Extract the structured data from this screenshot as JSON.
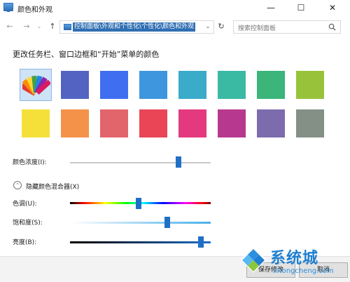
{
  "window": {
    "title": "颜色和外观",
    "minimize_glyph": "—",
    "maximize_glyph": "☐",
    "close_glyph": "✕"
  },
  "nav": {
    "back_glyph": "←",
    "forward_glyph": "→",
    "recent_glyph": "⌄",
    "up_glyph": "↑",
    "address": "控制面板\\外观和个性化\\个性化\\颜色和外观",
    "refresh_glyph": "↻",
    "dropdown_glyph": "⌄",
    "search_placeholder": "搜索控制面板"
  },
  "heading": "更改任务栏、窗口边框和“开始”菜单的颜色",
  "swatches": {
    "row1": [
      "custom",
      "#5363c2",
      "#3f6ff0",
      "#3d96de",
      "#3aabc9",
      "#3ab9a3",
      "#3bb57a",
      "#99c23b"
    ],
    "row2": [
      "#f5e03a",
      "#f5924a",
      "#e2656c",
      "#e94557",
      "#e4397f",
      "#b7398f",
      "#7c6cad",
      "#849086"
    ],
    "selected": "custom"
  },
  "intensity": {
    "label": "颜色浓度(I):",
    "value": 0.77
  },
  "mixer": {
    "toggle_glyph": "⌃",
    "label": "隐藏颜色混合器(X)",
    "hue": {
      "label": "色调(U):",
      "value": 0.49
    },
    "saturation": {
      "label": "饱和度(S):",
      "value": 0.69
    },
    "brightness": {
      "label": "亮度(B):",
      "value": 0.93
    }
  },
  "footer": {
    "save_label": "保存修改",
    "cancel_label": "取消"
  },
  "watermark": {
    "text": "系统城",
    "url": "xitongcheng.com"
  }
}
